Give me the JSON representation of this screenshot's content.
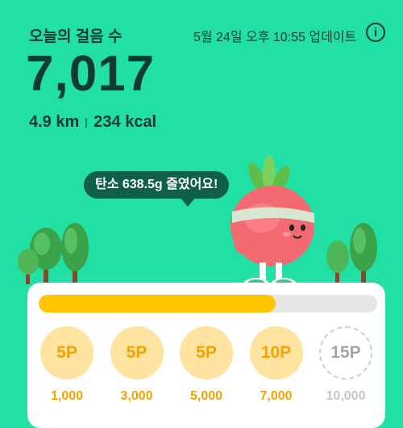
{
  "header": {
    "title": "오늘의 걸음 수",
    "updated": "5월 24일 오후 10:55 업데이트",
    "info_icon": "info-icon"
  },
  "summary": {
    "steps": "7,017",
    "distance": "4.9 km",
    "calories": "234 kcal"
  },
  "message": {
    "text": "탄소 638.5g 줄였어요!"
  },
  "progress": {
    "fraction": 0.7
  },
  "rewards": [
    {
      "points": "5P",
      "goal": "1,000",
      "state": "earned"
    },
    {
      "points": "5P",
      "goal": "3,000",
      "state": "earned"
    },
    {
      "points": "5P",
      "goal": "5,000",
      "state": "earned"
    },
    {
      "points": "10P",
      "goal": "7,000",
      "state": "earned"
    },
    {
      "points": "15P",
      "goal": "10,000",
      "state": "locked"
    }
  ],
  "colors": {
    "background": "#22dfa3",
    "text_dark": "#0f3b35",
    "bubble": "#0f5f4c",
    "progress_fill": "#ffc600",
    "coin_earned": "#ffe3a0",
    "coin_text": "#f4a300"
  }
}
